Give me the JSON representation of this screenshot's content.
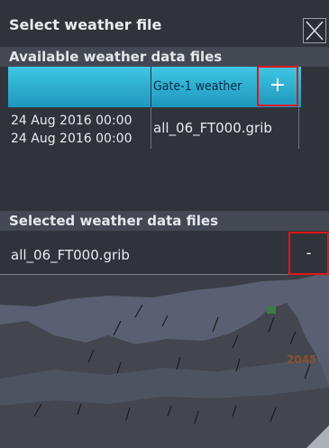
{
  "dialog": {
    "title": "Select weather file"
  },
  "available": {
    "header": "Available weather data files",
    "column2_label": "Gate-1 weather",
    "add_label": "+",
    "rows": [
      {
        "date_from": "24 Aug 2016 00:00",
        "date_to": "24 Aug 2016 00:00",
        "file": "all_06_FT000.grib"
      }
    ]
  },
  "selected": {
    "header": "Selected weather data files",
    "file": "all_06_FT000.grib",
    "remove_label": "-"
  },
  "map": {
    "label": "2045"
  },
  "colors": {
    "column_header_blue": "#2fb0d4",
    "highlight_red": "#e0161a",
    "map_land": "#616779",
    "map_water": "#3f424b"
  }
}
